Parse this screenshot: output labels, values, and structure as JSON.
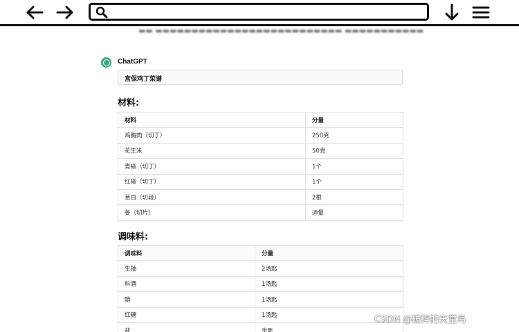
{
  "toolbar": {
    "search_value": "",
    "back_icon": "arrow-left-icon",
    "forward_icon": "arrow-right-icon",
    "search_icon": "search-icon",
    "download_icon": "arrow-down-icon",
    "menu_icon": "hamburger-menu-icon"
  },
  "chat": {
    "author": "ChatGPT",
    "recipe_title": "宫保鸡丁菜谱",
    "ingredients": {
      "heading": "材料:",
      "columns": [
        "材料",
        "分量"
      ],
      "rows": [
        [
          "鸡胸肉（切丁）",
          "250克"
        ],
        [
          "花生米",
          "50克"
        ],
        [
          "青椒（切丁）",
          "1个"
        ],
        [
          "红椒（切丁）",
          "1个"
        ],
        [
          "葱白（切段）",
          "2根"
        ],
        [
          "姜（切片）",
          "适量"
        ]
      ]
    },
    "seasonings": {
      "heading": "调味料:",
      "columns": [
        "调味料",
        "分量"
      ],
      "rows": [
        [
          "生抽",
          "2汤匙"
        ],
        [
          "料酒",
          "1汤匙"
        ],
        [
          "醋",
          "1汤匙"
        ],
        [
          "红糖",
          "1汤匙"
        ],
        [
          "盐",
          "半匙"
        ]
      ]
    }
  },
  "watermark": "CSDN @破碎的天堂鸟",
  "colors": {
    "avatar": "#3aa882",
    "border": "#e0e0e0",
    "toolbar_outline": "#111111"
  }
}
